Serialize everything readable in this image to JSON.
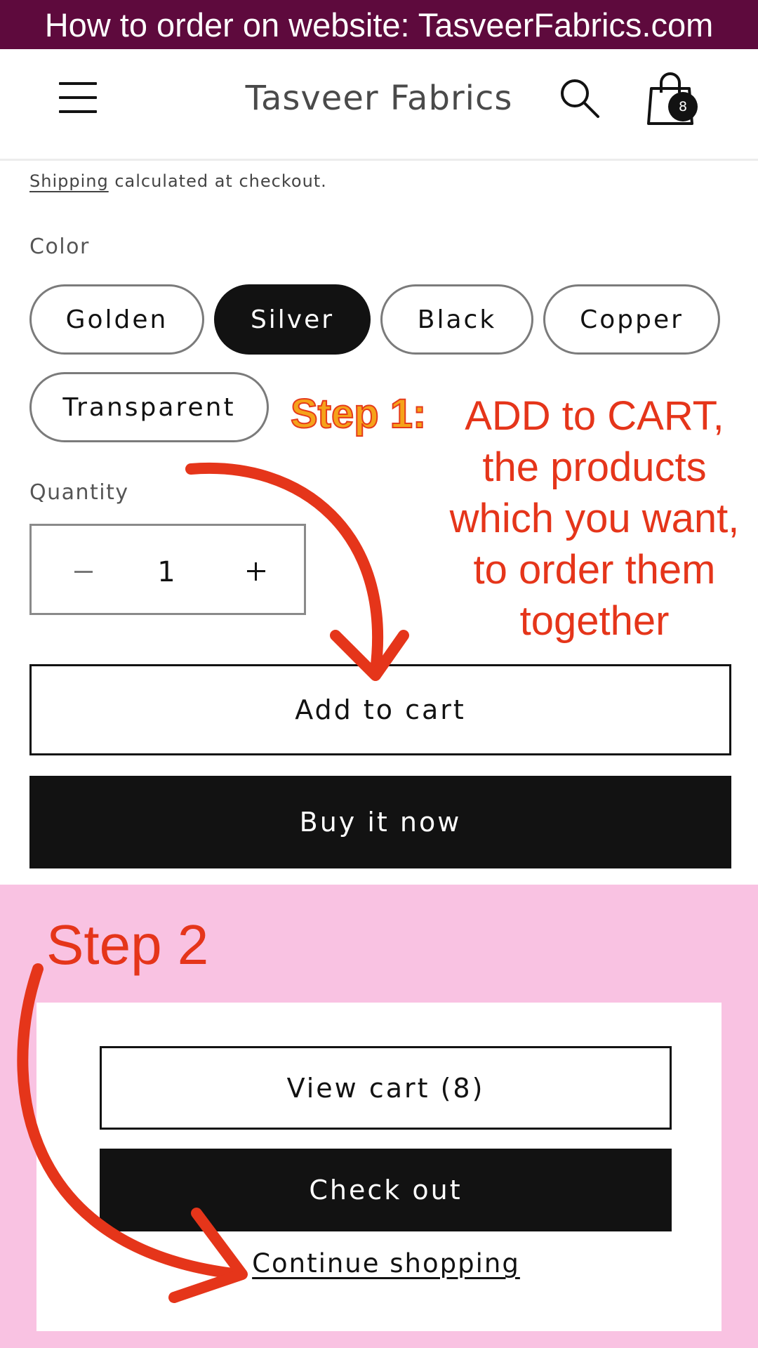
{
  "banner": {
    "text": "How to order on website: TasveerFabrics.com"
  },
  "header": {
    "brand": "Tasveer Fabrics",
    "cart_count": "8",
    "icons": [
      "hamburger-menu-icon",
      "search-icon",
      "shopping-bag-icon"
    ]
  },
  "product": {
    "shipping_link": "Shipping",
    "shipping_rest": " calculated at checkout.",
    "color_label": "Color",
    "colors": [
      {
        "label": "Golden",
        "selected": false
      },
      {
        "label": "Silver",
        "selected": true
      },
      {
        "label": "Black",
        "selected": false
      },
      {
        "label": "Copper",
        "selected": false
      },
      {
        "label": "Transparent",
        "selected": false
      }
    ],
    "quantity_label": "Quantity",
    "quantity_value": "1",
    "add_to_cart": "Add to cart",
    "buy_now": "Buy it now"
  },
  "cart_popup": {
    "view_cart": "View cart (8)",
    "check_out": "Check out",
    "continue_shopping": "Continue shopping"
  },
  "annotations": {
    "step1_title": "Step 1:",
    "step1_lines": [
      "ADD to CART,",
      "the products",
      "which you want,",
      "to order them",
      "together"
    ],
    "step2": "Step 2"
  },
  "colors": {
    "banner_bg": "#5e0a3d",
    "pink_bg": "#f9c2e2",
    "annotation_red": "#e5351a",
    "annotation_orange": "#f5a31a",
    "dark": "#121212"
  }
}
